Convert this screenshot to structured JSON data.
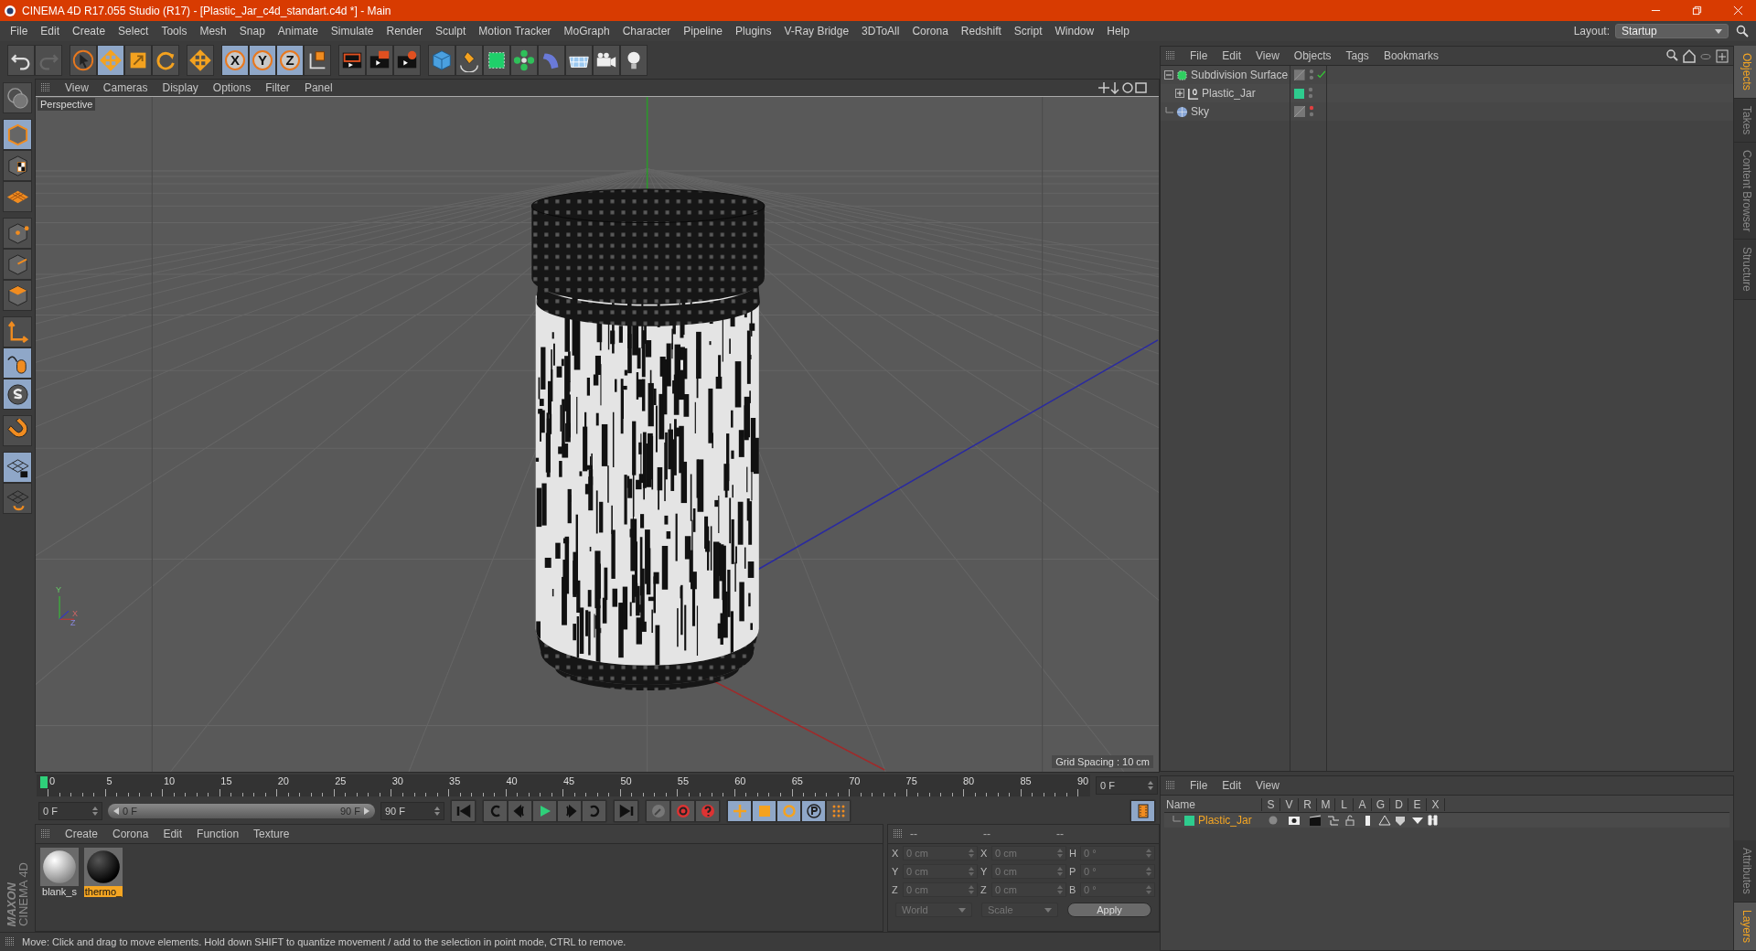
{
  "title_bar": {
    "title": "CINEMA 4D R17.055 Studio (R17) - [Plastic_Jar_c4d_standart.c4d *] - Main"
  },
  "menu_bar": [
    "File",
    "Edit",
    "Create",
    "Select",
    "Tools",
    "Mesh",
    "Snap",
    "Animate",
    "Simulate",
    "Render",
    "Sculpt",
    "Motion Tracker",
    "MoGraph",
    "Character",
    "Pipeline",
    "Plugins",
    "V-Ray Bridge",
    "3DToAll",
    "Corona",
    "Redshift",
    "Script",
    "Window",
    "Help"
  ],
  "layout": {
    "label": "Layout:",
    "value": "Startup"
  },
  "main_toolbar": [
    {
      "kind": "undo",
      "selected": false
    },
    {
      "kind": "redo",
      "selected": false
    },
    {
      "kind": "gap"
    },
    {
      "kind": "select",
      "selected": false
    },
    {
      "kind": "move",
      "selected": true
    },
    {
      "kind": "scale",
      "selected": false
    },
    {
      "kind": "rotate",
      "selected": false
    },
    {
      "kind": "gap"
    },
    {
      "kind": "move2",
      "selected": false
    },
    {
      "kind": "gap"
    },
    {
      "kind": "axis",
      "label": "X",
      "selected": true
    },
    {
      "kind": "axis",
      "label": "Y",
      "selected": true
    },
    {
      "kind": "axis",
      "label": "Z",
      "selected": true
    },
    {
      "kind": "coord",
      "selected": false
    },
    {
      "kind": "gap"
    },
    {
      "kind": "render_view",
      "selected": false
    },
    {
      "kind": "render_picture",
      "selected": false
    },
    {
      "kind": "render_settings",
      "selected": false
    },
    {
      "kind": "gap"
    },
    {
      "kind": "cube",
      "selected": false
    },
    {
      "kind": "pen",
      "selected": false
    },
    {
      "kind": "subdivision",
      "selected": false
    },
    {
      "kind": "array",
      "selected": false
    },
    {
      "kind": "deformer",
      "selected": false
    },
    {
      "kind": "floor",
      "selected": false
    },
    {
      "kind": "camera",
      "selected": false
    },
    {
      "kind": "light",
      "selected": false
    }
  ],
  "left_toolbar": [
    {
      "kind": "model",
      "selected": false
    },
    {
      "kind": "gap"
    },
    {
      "kind": "object",
      "selected": true
    },
    {
      "kind": "texture",
      "selected": false
    },
    {
      "kind": "workplane",
      "selected": false
    },
    {
      "kind": "gap"
    },
    {
      "kind": "points",
      "selected": false
    },
    {
      "kind": "edges",
      "selected": false
    },
    {
      "kind": "polygons",
      "selected": false
    },
    {
      "kind": "gap"
    },
    {
      "kind": "axis_tool",
      "selected": false
    },
    {
      "kind": "tweak",
      "selected": true
    },
    {
      "kind": "snap",
      "selected": true
    },
    {
      "kind": "gap"
    },
    {
      "kind": "magnet",
      "selected": false
    },
    {
      "kind": "gap"
    },
    {
      "kind": "lock_workplane",
      "selected": true
    },
    {
      "kind": "workplane_rotate",
      "selected": false
    }
  ],
  "logo": {
    "brand": "MAXON",
    "product": "CINEMA 4D"
  },
  "viewport": {
    "menu": [
      "View",
      "Cameras",
      "Display",
      "Options",
      "Filter",
      "Panel"
    ],
    "camera": "Perspective",
    "grid_spacing": "Grid Spacing : 10 cm",
    "gizmo_labels": [
      "Y",
      "X",
      "Z"
    ]
  },
  "timeline": {
    "ruler_labels": [
      "0",
      "5",
      "10",
      "15",
      "20",
      "25",
      "30",
      "35",
      "40",
      "45",
      "50",
      "55",
      "60",
      "65",
      "70",
      "75",
      "80",
      "85",
      "90"
    ],
    "playhead": {
      "level": 0
    },
    "current_frame": "0 F"
  },
  "playback": {
    "start": "0 F",
    "range": {
      "start": "0 F",
      "end": "90 F"
    },
    "end": "90 F"
  },
  "materials": {
    "menu": [
      "Create",
      "Corona",
      "Edit",
      "Function",
      "Texture"
    ],
    "items": [
      {
        "name": "blank_s",
        "kind": "white",
        "selected": false
      },
      {
        "name": "thermo_",
        "kind": "black",
        "selected": true
      }
    ]
  },
  "coordinates": {
    "headers": [
      "--",
      "--",
      "--"
    ],
    "rows": [
      {
        "pos_axis": "X",
        "position": "0 cm",
        "size_axis": "X",
        "size": "0 cm",
        "rot_axis": "H",
        "rotation": "0 °"
      },
      {
        "pos_axis": "Y",
        "position": "0 cm",
        "size_axis": "Y",
        "size": "0 cm",
        "rot_axis": "P",
        "rotation": "0 °"
      },
      {
        "pos_axis": "Z",
        "position": "0 cm",
        "size_axis": "Z",
        "size": "0 cm",
        "rot_axis": "B",
        "rotation": "0 °"
      }
    ],
    "dropdowns": [
      "World",
      "Scale"
    ],
    "apply": "Apply"
  },
  "status_bar": "Move: Click and drag to move elements. Hold down SHIFT to quantize movement / add to the selection in point mode, CTRL to remove.",
  "object_manager": {
    "menu": [
      "File",
      "Edit",
      "View",
      "Objects",
      "Tags",
      "Bookmarks"
    ],
    "objects": [
      {
        "name": "Subdivision Surface",
        "kind": "subdivision",
        "expanded": true,
        "render_off": false,
        "children": [
          {
            "name": "Plastic_Jar",
            "kind": "null",
            "expanded": false,
            "render_off": false,
            "color": "#2ecc8e"
          }
        ]
      },
      {
        "name": "Sky",
        "kind": "sky",
        "render_off": true
      }
    ]
  },
  "layer_manager": {
    "menu": [
      "File",
      "Edit",
      "View"
    ],
    "columns": [
      "Name",
      "S",
      "V",
      "R",
      "M",
      "L",
      "A",
      "G",
      "D",
      "E",
      "X"
    ],
    "layers": [
      {
        "name": "Plastic_Jar",
        "color": "#2ecc8e"
      }
    ]
  },
  "side_tabs_top": [
    {
      "label": "Objects",
      "selected": true
    },
    {
      "label": "Takes",
      "selected": false
    },
    {
      "label": "Content Browser",
      "selected": false
    },
    {
      "label": "Structure",
      "selected": false
    }
  ],
  "side_tabs_bottom": [
    {
      "label": "Attributes",
      "selected": false
    },
    {
      "label": "Layers",
      "selected": true
    }
  ]
}
